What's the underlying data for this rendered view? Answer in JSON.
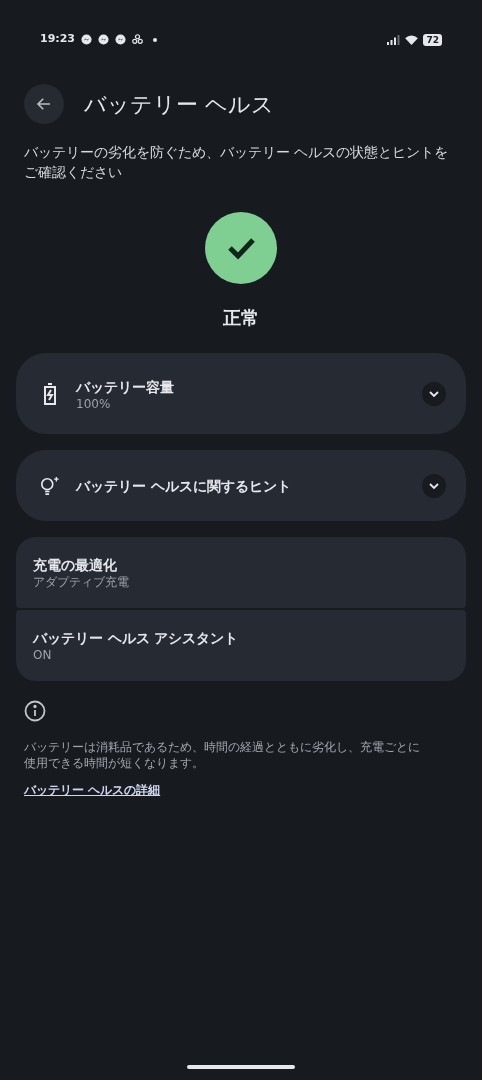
{
  "status_bar": {
    "time": "19:23",
    "battery": "72"
  },
  "header": {
    "title": "バッテリー ヘルス"
  },
  "description": "バッテリーの劣化を防ぐため、バッテリー ヘルスの状態とヒントをご確認ください",
  "status": {
    "label": "正常"
  },
  "cards": [
    {
      "kind": "battery",
      "title": "バッテリー容量",
      "subtitle": "100%",
      "expanded": false
    },
    {
      "kind": "hint",
      "title": "バッテリー ヘルスに関するヒント",
      "expanded": false
    }
  ],
  "settings": [
    {
      "title": "充電の最適化",
      "subtitle": "アダプティブ充電"
    },
    {
      "title": "バッテリー ヘルス アシスタント",
      "subtitle": "ON"
    }
  ],
  "footer": {
    "note": "バッテリーは消耗品であるため、時間の経過とともに劣化し、充電ごとに使用できる時間が短くなります。",
    "link": "バッテリー ヘルスの詳細"
  }
}
